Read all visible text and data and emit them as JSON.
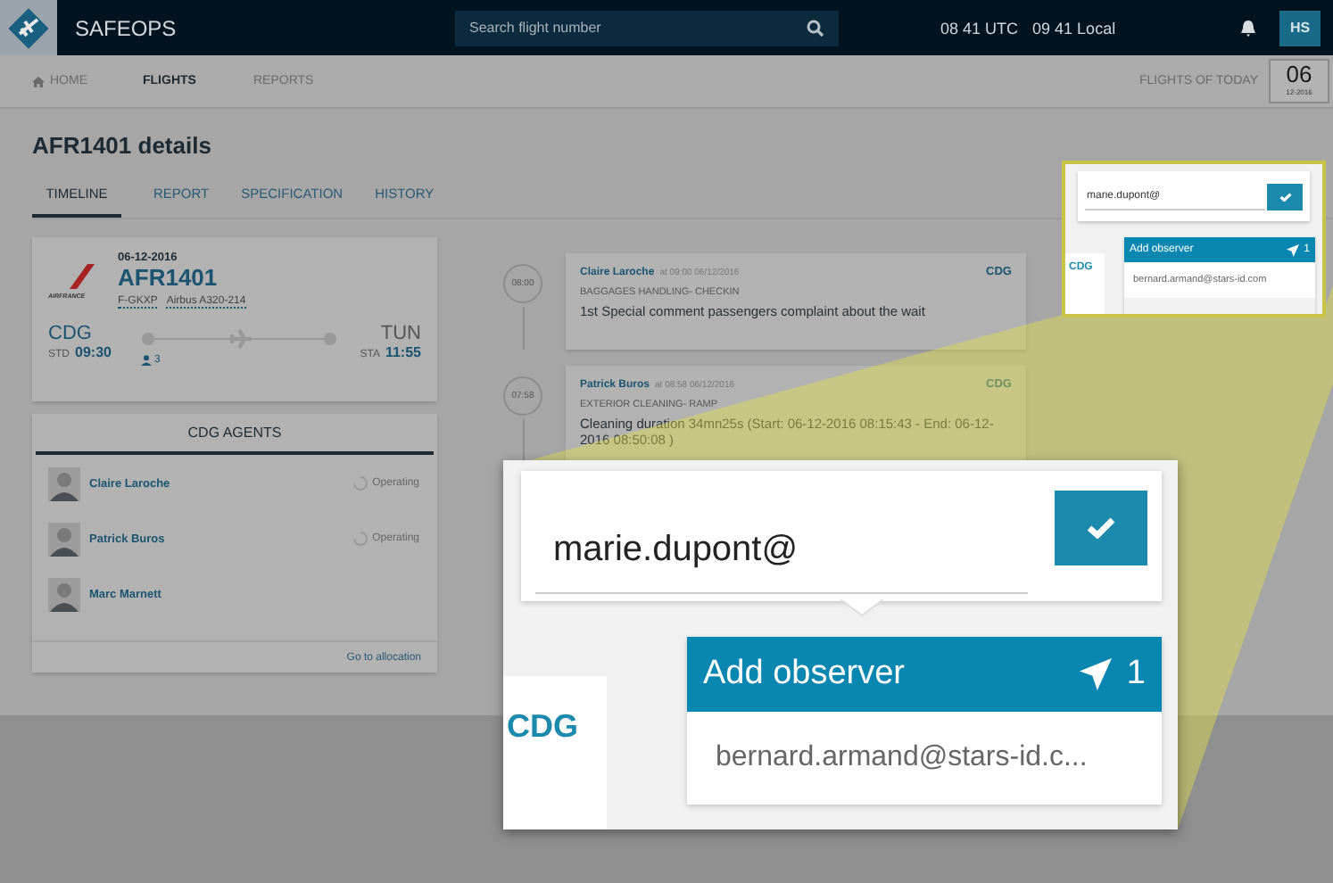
{
  "header": {
    "app_name": "SAFEOPS",
    "search": {
      "placeholder": "Search flight number"
    },
    "utc_time": "08 41 UTC",
    "local_time": "09 41 Local",
    "user_initials": "HS"
  },
  "nav": {
    "items": [
      {
        "label": "HOME",
        "selected": false
      },
      {
        "label": "FLIGHTS",
        "selected": true
      },
      {
        "label": "REPORTS",
        "selected": false
      }
    ],
    "flights_of_today": "FLIGHTS OF TODAY",
    "date_badge": {
      "day": "06",
      "month_year": "12-2016"
    }
  },
  "page_title": "AFR1401 details",
  "tabs": [
    {
      "label": "TIMELINE",
      "selected": true
    },
    {
      "label": "REPORT",
      "selected": false
    },
    {
      "label": "SPECIFICATION",
      "selected": false
    },
    {
      "label": "HISTORY",
      "selected": false
    }
  ],
  "flight_card": {
    "logo_text": "AIRFRANCE",
    "date": "06-12-2016",
    "flight": "AFR1401",
    "registration": "F-GKXP",
    "aircraft": "Airbus A320-214",
    "origin": "CDG",
    "std_label": "STD",
    "std": "09:30",
    "passengers": "3",
    "destination": "TUN",
    "sta_label": "STA",
    "sta": "11:55"
  },
  "agents": {
    "title": "CDG AGENTS",
    "items": [
      {
        "name": "Claire Laroche",
        "status": "Operating"
      },
      {
        "name": "Patrick Buros",
        "status": "Operating"
      },
      {
        "name": "Marc Marnett"
      }
    ],
    "link": "Go to allocation"
  },
  "timeline": [
    {
      "time": "08:00",
      "author": "Claire Laroche",
      "at": "at 09:00 06/12/2016",
      "station": "CDG",
      "activity": "BAGGAGES HANDLING- CHECKIN",
      "comment": "1st Special comment passengers complaint about the wait"
    },
    {
      "time": "07:58",
      "author": "Patrick Buros",
      "at": "at 08:58 06/12/2016",
      "station": "CDG",
      "activity": "EXTERIOR CLEANING- RAMP",
      "comment": "Cleaning duration 34mn25s (Start: 06-12-2016 08:15:43 - End: 06-12-2016 08:50:08 )"
    }
  ],
  "observer_popup": {
    "input_value": "marie.dupont@",
    "station": "CDG",
    "header": "Add observer",
    "count": "1",
    "suggestion": "bernard.armand@stars-id.com"
  },
  "magnified_popup": {
    "input_value": "marie.dupont@",
    "station": "CDG",
    "header": "Add observer",
    "count": "1",
    "suggestion": "bernard.armand@stars-id.c..."
  }
}
